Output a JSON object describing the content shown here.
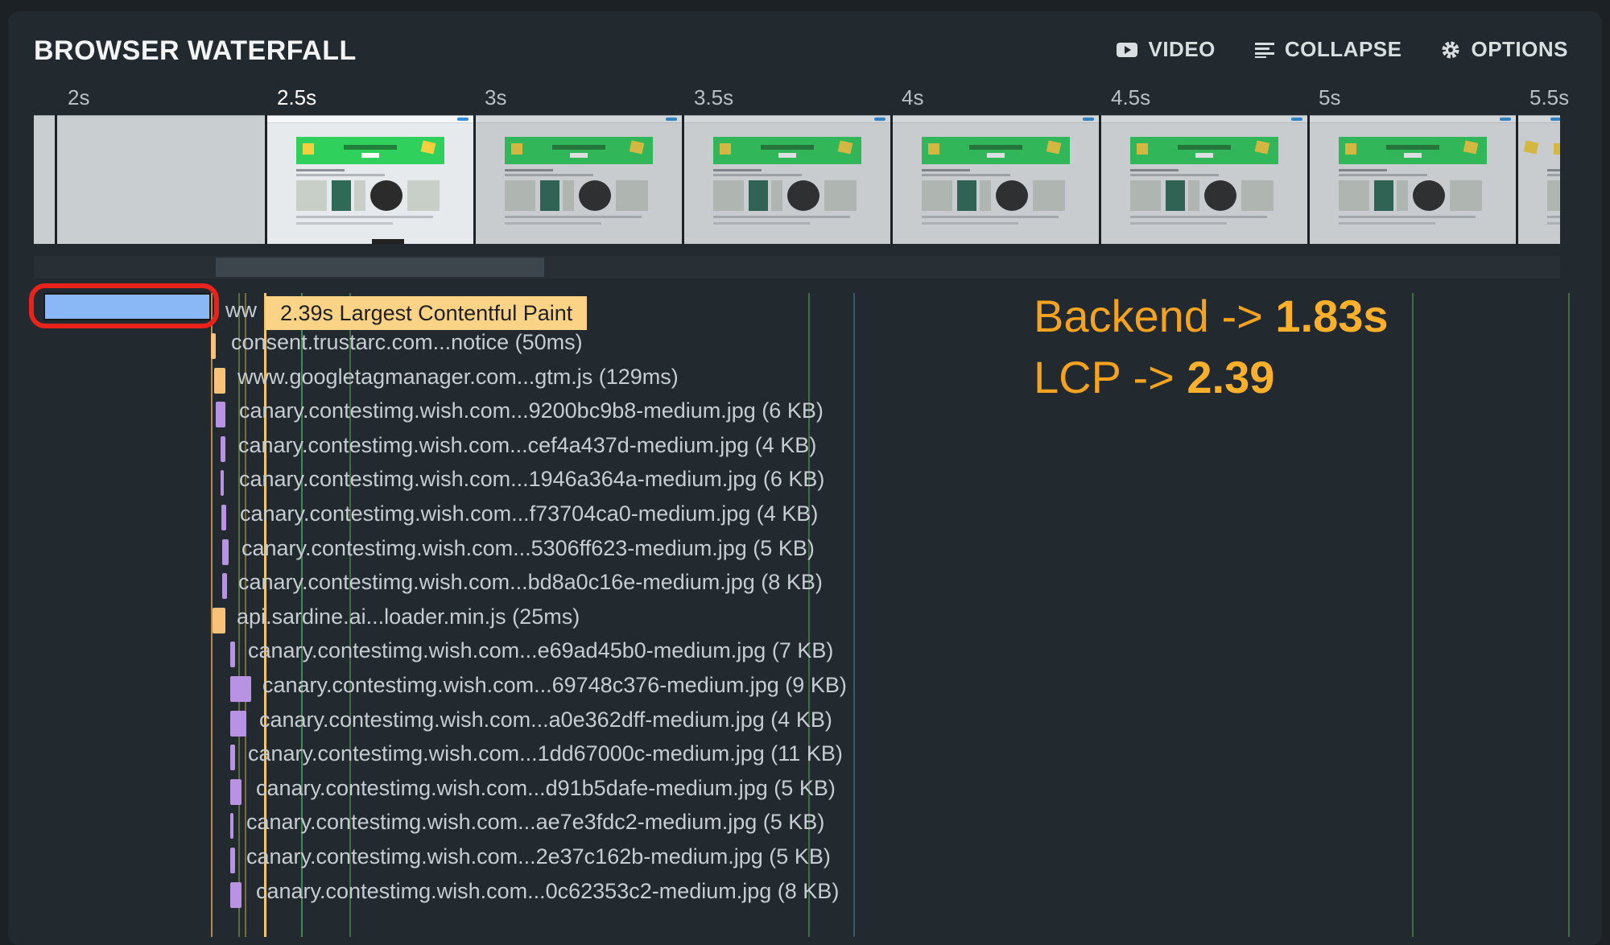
{
  "panel": {
    "title": "BROWSER WATERFALL",
    "toolbar": {
      "video_label": "VIDEO",
      "collapse_label": "COLLAPSE",
      "options_label": "OPTIONS"
    }
  },
  "timeline": {
    "ticks": [
      "2s",
      "2.5s",
      "3s",
      "3.5s",
      "4s",
      "4.5s",
      "5s",
      "5.5s"
    ],
    "active_tick": "2.5s"
  },
  "lcp_marker": {
    "label": "2.39s Largest Contentful Paint"
  },
  "first_request_prefix": "ww",
  "requests": [
    {
      "label": "consent.trustarc.com...notice (50ms)",
      "type": "js"
    },
    {
      "label": "www.googletagmanager.com...gtm.js (129ms)",
      "type": "js"
    },
    {
      "label": "canary.contestimg.wish.com...9200bc9b8-medium.jpg (6 KB)",
      "type": "img"
    },
    {
      "label": "canary.contestimg.wish.com...cef4a437d-medium.jpg (4 KB)",
      "type": "img"
    },
    {
      "label": "canary.contestimg.wish.com...1946a364a-medium.jpg (6 KB)",
      "type": "img"
    },
    {
      "label": "canary.contestimg.wish.com...f73704ca0-medium.jpg (4 KB)",
      "type": "img"
    },
    {
      "label": "canary.contestimg.wish.com...5306ff623-medium.jpg (5 KB)",
      "type": "img"
    },
    {
      "label": "canary.contestimg.wish.com...bd8a0c16e-medium.jpg (8 KB)",
      "type": "img"
    },
    {
      "label": "api.sardine.ai...loader.min.js (25ms)",
      "type": "js"
    },
    {
      "label": "canary.contestimg.wish.com...e69ad45b0-medium.jpg (7 KB)",
      "type": "img"
    },
    {
      "label": "canary.contestimg.wish.com...69748c376-medium.jpg (9 KB)",
      "type": "img"
    },
    {
      "label": "canary.contestimg.wish.com...a0e362dff-medium.jpg (4 KB)",
      "type": "img"
    },
    {
      "label": "canary.contestimg.wish.com...1dd67000c-medium.jpg (11 KB)",
      "type": "img"
    },
    {
      "label": "canary.contestimg.wish.com...d91b5dafe-medium.jpg (5 KB)",
      "type": "img"
    },
    {
      "label": "canary.contestimg.wish.com...ae7e3fdc2-medium.jpg (5 KB)",
      "type": "img"
    },
    {
      "label": "canary.contestimg.wish.com...2e37c162b-medium.jpg (5 KB)",
      "type": "img"
    },
    {
      "label": "canary.contestimg.wish.com...0c62353c2-medium.jpg (8 KB)",
      "type": "img"
    }
  ],
  "annotations": {
    "backend_prefix": "Backend -> ",
    "backend_value": "1.83s",
    "lcp_prefix": "LCP -> ",
    "lcp_value": "2.39"
  },
  "colors": {
    "js": "#f8c27a",
    "img": "#b892e3",
    "highlight": "#e8231c",
    "annotation": "#f5a21e",
    "lcp_tag": "#fbd386"
  }
}
